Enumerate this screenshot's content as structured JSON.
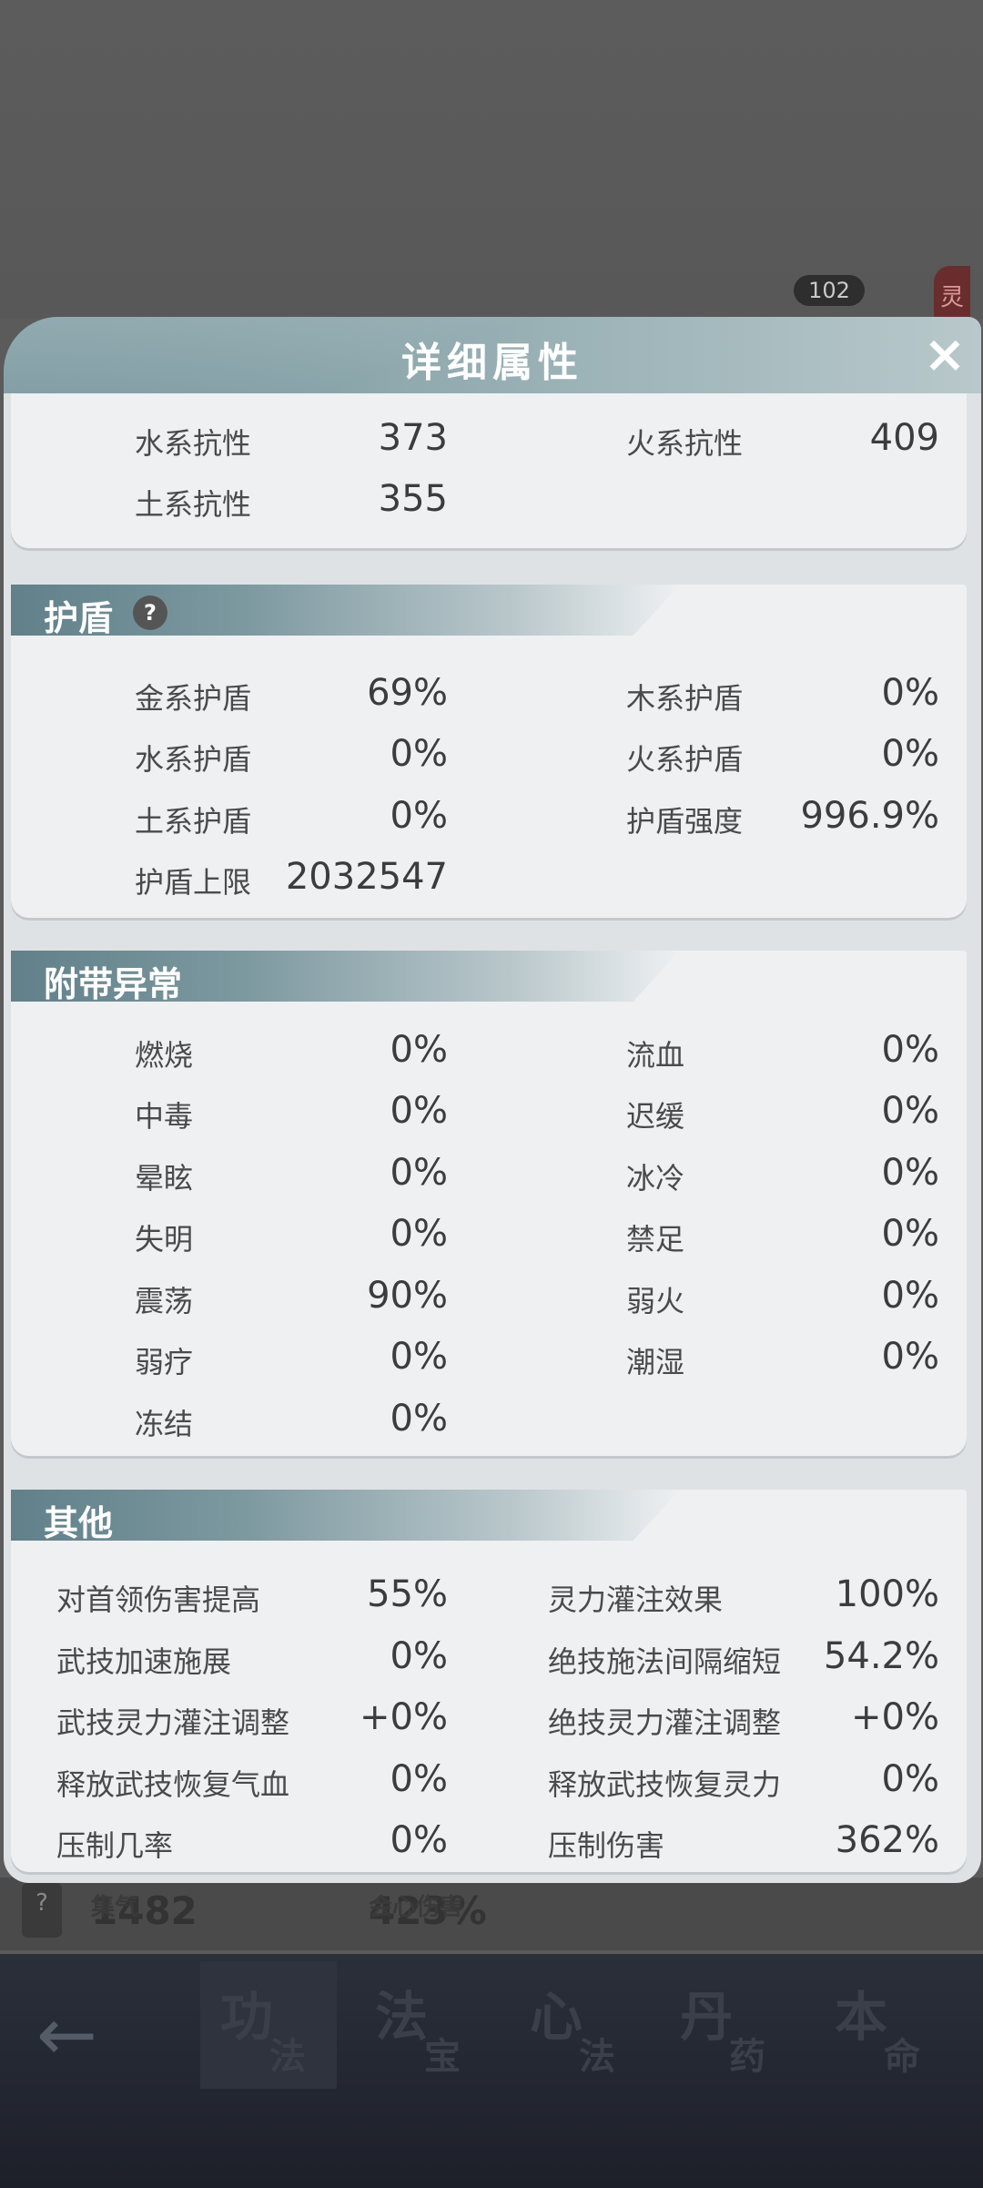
{
  "modal": {
    "title": "详细属性",
    "close_icon": "×"
  },
  "resist": {
    "rows": [
      {
        "l1": "水系抗性",
        "v1": "373",
        "l2": "火系抗性",
        "v2": "409"
      },
      {
        "l1": "土系抗性",
        "v1": "355"
      }
    ]
  },
  "shield": {
    "title": "护盾",
    "help": "?",
    "rows": [
      {
        "l1": "金系护盾",
        "v1": "69%",
        "l2": "木系护盾",
        "v2": "0%"
      },
      {
        "l1": "水系护盾",
        "v1": "0%",
        "l2": "火系护盾",
        "v2": "0%"
      },
      {
        "l1": "土系护盾",
        "v1": "0%",
        "l2": "护盾强度",
        "v2": "996.9%"
      },
      {
        "l1": "护盾上限",
        "v1": "2032547"
      }
    ]
  },
  "abnormal": {
    "title": "附带异常",
    "rows": [
      {
        "l1": "燃烧",
        "v1": "0%",
        "l2": "流血",
        "v2": "0%"
      },
      {
        "l1": "中毒",
        "v1": "0%",
        "l2": "迟缓",
        "v2": "0%"
      },
      {
        "l1": "晕眩",
        "v1": "0%",
        "l2": "冰冷",
        "v2": "0%"
      },
      {
        "l1": "失明",
        "v1": "0%",
        "l2": "禁足",
        "v2": "0%"
      },
      {
        "l1": "震荡",
        "v1": "90%",
        "l2": "弱火",
        "v2": "0%"
      },
      {
        "l1": "弱疗",
        "v1": "0%",
        "l2": "潮湿",
        "v2": "0%"
      },
      {
        "l1": "冻结",
        "v1": "0%"
      }
    ]
  },
  "other": {
    "title": "其他",
    "rows": [
      {
        "l1": "对首领伤害提高",
        "v1": "55%",
        "l2": "灵力灌注效果",
        "v2": "100%"
      },
      {
        "l1": "武技加速施展",
        "v1": "0%",
        "l2": "绝技施法间隔缩短",
        "v2": "54.2%"
      },
      {
        "l1": "武技灵力灌注调整",
        "v1": "+0%",
        "l2": "绝技灵力灌注调整",
        "v2": "+0%"
      },
      {
        "l1": "释放武技恢复气血",
        "v1": "0%",
        "l2": "释放武技恢复灵力",
        "v2": "0%"
      },
      {
        "l1": "压制几率",
        "v1": "0%",
        "l2": "压制伤害",
        "v2": "362%"
      }
    ]
  },
  "background": {
    "badge": "102",
    "red_tag": "灵",
    "help": "?",
    "stat1_label": "集气",
    "stat1_value": "1482",
    "stat2_label": "会心伤害",
    "stat2_value": "423%",
    "nav_back": "←",
    "tabs": [
      {
        "big": "功",
        "small": "法"
      },
      {
        "big": "法",
        "small": "宝"
      },
      {
        "big": "心",
        "small": "法"
      },
      {
        "big": "丹",
        "small": "药"
      },
      {
        "big": "本",
        "small": "命"
      }
    ]
  }
}
